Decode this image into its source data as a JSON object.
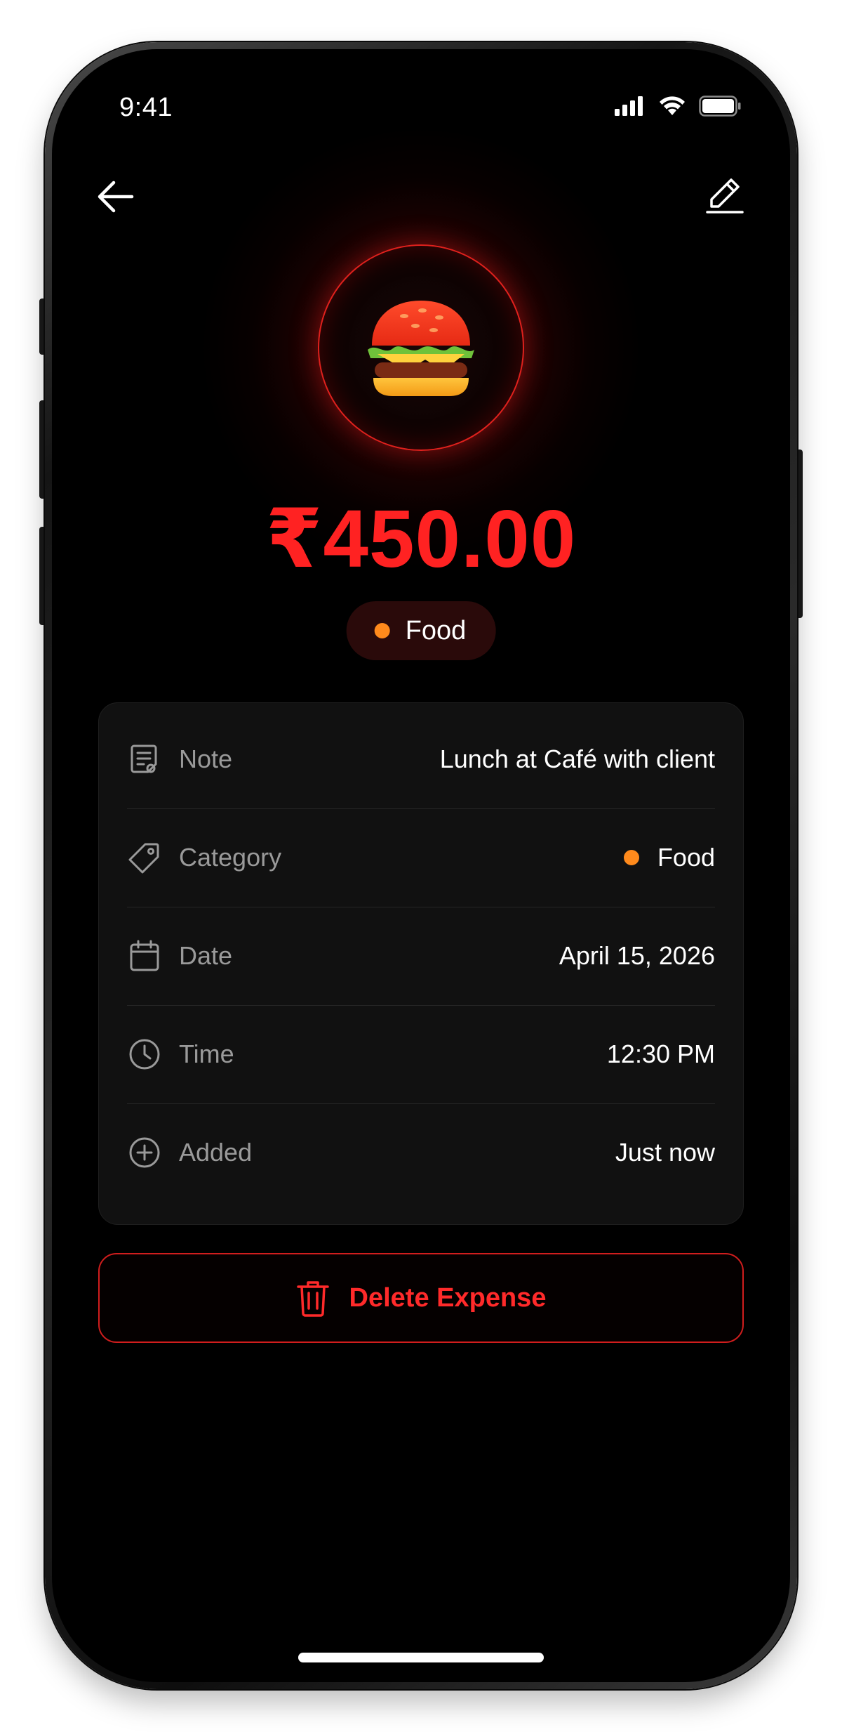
{
  "status_bar": {
    "time": "9:41",
    "icons": [
      "signal-icon",
      "wifi-icon",
      "battery-icon"
    ]
  },
  "nav": {
    "back_icon": "arrow-left-icon",
    "edit_icon": "pencil-icon"
  },
  "expense": {
    "icon": "burger-icon",
    "amount": "₹450.00",
    "category_pill": "Food",
    "category_color": "#ff8a1c",
    "accent_color": "#ff2222"
  },
  "details": [
    {
      "icon": "note-icon",
      "label": "Note",
      "value": "Lunch at Café with client"
    },
    {
      "icon": "tag-icon",
      "label": "Category",
      "value": "Food"
    },
    {
      "icon": "calendar-icon",
      "label": "Date",
      "value": "April 15, 2026"
    },
    {
      "icon": "clock-icon",
      "label": "Time",
      "value": "12:30 PM"
    },
    {
      "icon": "plus-circle-icon",
      "label": "Added",
      "value": "Just now"
    }
  ],
  "actions": {
    "delete_label": "Delete Expense",
    "delete_icon": "trash-icon"
  }
}
